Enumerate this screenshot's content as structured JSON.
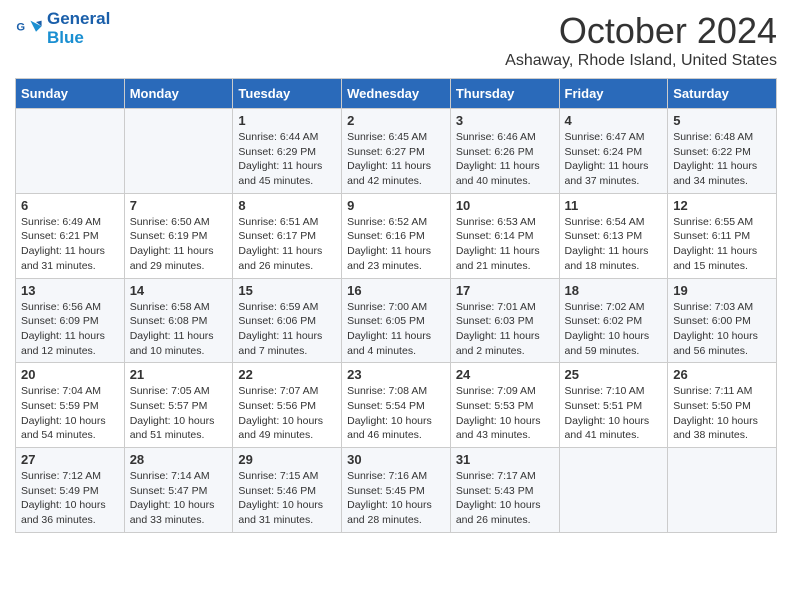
{
  "logo": {
    "line1": "General",
    "line2": "Blue"
  },
  "title": "October 2024",
  "subtitle": "Ashaway, Rhode Island, United States",
  "days_of_week": [
    "Sunday",
    "Monday",
    "Tuesday",
    "Wednesday",
    "Thursday",
    "Friday",
    "Saturday"
  ],
  "weeks": [
    [
      {
        "day": "",
        "content": ""
      },
      {
        "day": "",
        "content": ""
      },
      {
        "day": "1",
        "content": "Sunrise: 6:44 AM\nSunset: 6:29 PM\nDaylight: 11 hours and 45 minutes."
      },
      {
        "day": "2",
        "content": "Sunrise: 6:45 AM\nSunset: 6:27 PM\nDaylight: 11 hours and 42 minutes."
      },
      {
        "day": "3",
        "content": "Sunrise: 6:46 AM\nSunset: 6:26 PM\nDaylight: 11 hours and 40 minutes."
      },
      {
        "day": "4",
        "content": "Sunrise: 6:47 AM\nSunset: 6:24 PM\nDaylight: 11 hours and 37 minutes."
      },
      {
        "day": "5",
        "content": "Sunrise: 6:48 AM\nSunset: 6:22 PM\nDaylight: 11 hours and 34 minutes."
      }
    ],
    [
      {
        "day": "6",
        "content": "Sunrise: 6:49 AM\nSunset: 6:21 PM\nDaylight: 11 hours and 31 minutes."
      },
      {
        "day": "7",
        "content": "Sunrise: 6:50 AM\nSunset: 6:19 PM\nDaylight: 11 hours and 29 minutes."
      },
      {
        "day": "8",
        "content": "Sunrise: 6:51 AM\nSunset: 6:17 PM\nDaylight: 11 hours and 26 minutes."
      },
      {
        "day": "9",
        "content": "Sunrise: 6:52 AM\nSunset: 6:16 PM\nDaylight: 11 hours and 23 minutes."
      },
      {
        "day": "10",
        "content": "Sunrise: 6:53 AM\nSunset: 6:14 PM\nDaylight: 11 hours and 21 minutes."
      },
      {
        "day": "11",
        "content": "Sunrise: 6:54 AM\nSunset: 6:13 PM\nDaylight: 11 hours and 18 minutes."
      },
      {
        "day": "12",
        "content": "Sunrise: 6:55 AM\nSunset: 6:11 PM\nDaylight: 11 hours and 15 minutes."
      }
    ],
    [
      {
        "day": "13",
        "content": "Sunrise: 6:56 AM\nSunset: 6:09 PM\nDaylight: 11 hours and 12 minutes."
      },
      {
        "day": "14",
        "content": "Sunrise: 6:58 AM\nSunset: 6:08 PM\nDaylight: 11 hours and 10 minutes."
      },
      {
        "day": "15",
        "content": "Sunrise: 6:59 AM\nSunset: 6:06 PM\nDaylight: 11 hours and 7 minutes."
      },
      {
        "day": "16",
        "content": "Sunrise: 7:00 AM\nSunset: 6:05 PM\nDaylight: 11 hours and 4 minutes."
      },
      {
        "day": "17",
        "content": "Sunrise: 7:01 AM\nSunset: 6:03 PM\nDaylight: 11 hours and 2 minutes."
      },
      {
        "day": "18",
        "content": "Sunrise: 7:02 AM\nSunset: 6:02 PM\nDaylight: 10 hours and 59 minutes."
      },
      {
        "day": "19",
        "content": "Sunrise: 7:03 AM\nSunset: 6:00 PM\nDaylight: 10 hours and 56 minutes."
      }
    ],
    [
      {
        "day": "20",
        "content": "Sunrise: 7:04 AM\nSunset: 5:59 PM\nDaylight: 10 hours and 54 minutes."
      },
      {
        "day": "21",
        "content": "Sunrise: 7:05 AM\nSunset: 5:57 PM\nDaylight: 10 hours and 51 minutes."
      },
      {
        "day": "22",
        "content": "Sunrise: 7:07 AM\nSunset: 5:56 PM\nDaylight: 10 hours and 49 minutes."
      },
      {
        "day": "23",
        "content": "Sunrise: 7:08 AM\nSunset: 5:54 PM\nDaylight: 10 hours and 46 minutes."
      },
      {
        "day": "24",
        "content": "Sunrise: 7:09 AM\nSunset: 5:53 PM\nDaylight: 10 hours and 43 minutes."
      },
      {
        "day": "25",
        "content": "Sunrise: 7:10 AM\nSunset: 5:51 PM\nDaylight: 10 hours and 41 minutes."
      },
      {
        "day": "26",
        "content": "Sunrise: 7:11 AM\nSunset: 5:50 PM\nDaylight: 10 hours and 38 minutes."
      }
    ],
    [
      {
        "day": "27",
        "content": "Sunrise: 7:12 AM\nSunset: 5:49 PM\nDaylight: 10 hours and 36 minutes."
      },
      {
        "day": "28",
        "content": "Sunrise: 7:14 AM\nSunset: 5:47 PM\nDaylight: 10 hours and 33 minutes."
      },
      {
        "day": "29",
        "content": "Sunrise: 7:15 AM\nSunset: 5:46 PM\nDaylight: 10 hours and 31 minutes."
      },
      {
        "day": "30",
        "content": "Sunrise: 7:16 AM\nSunset: 5:45 PM\nDaylight: 10 hours and 28 minutes."
      },
      {
        "day": "31",
        "content": "Sunrise: 7:17 AM\nSunset: 5:43 PM\nDaylight: 10 hours and 26 minutes."
      },
      {
        "day": "",
        "content": ""
      },
      {
        "day": "",
        "content": ""
      }
    ]
  ]
}
